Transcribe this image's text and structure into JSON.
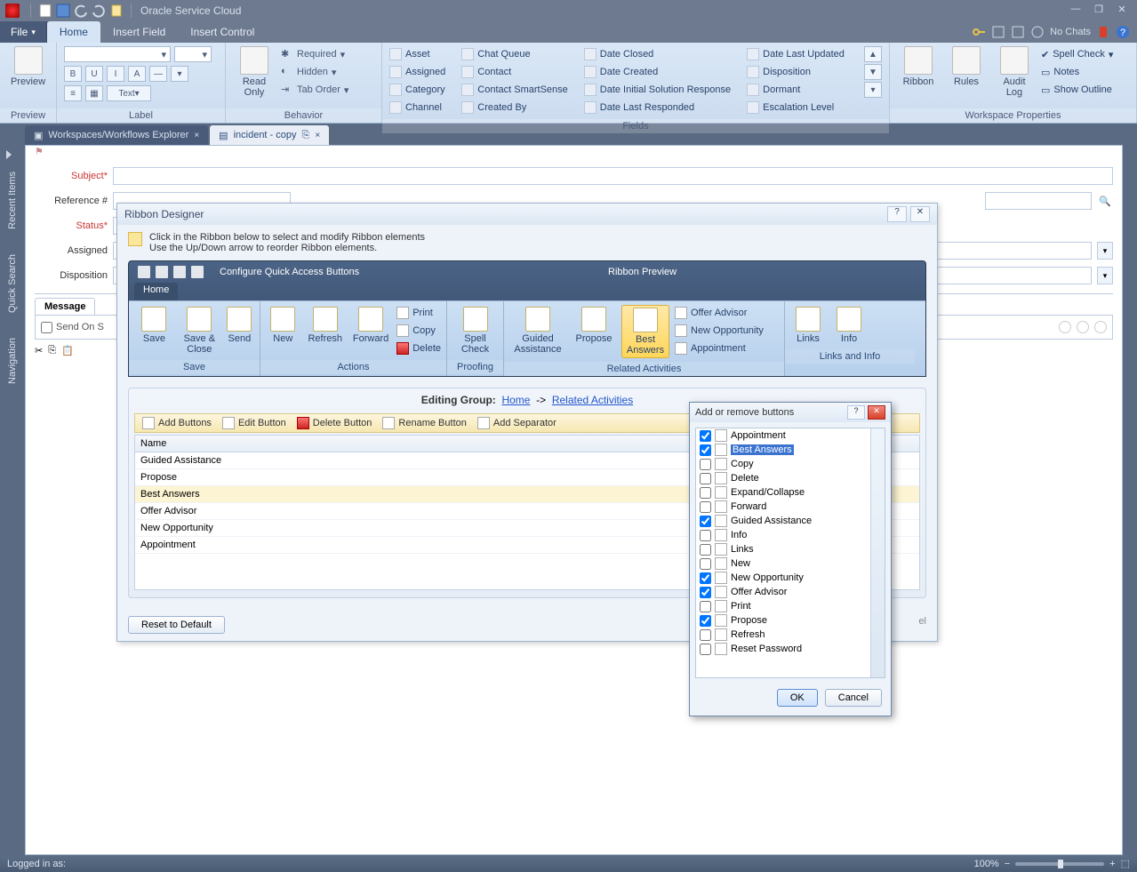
{
  "titlebar": {
    "app_title": "Oracle Service Cloud"
  },
  "menubar": {
    "file": "File",
    "tabs": [
      "Home",
      "Insert Field",
      "Insert Control"
    ],
    "no_chats": "No Chats"
  },
  "ribbon": {
    "groups": {
      "preview": {
        "label": "Preview",
        "btn": "Preview"
      },
      "label": {
        "label": "Label",
        "font_buttons": [
          "B",
          "U",
          "I"
        ],
        "text_btn": "Text"
      },
      "behavior": {
        "label": "Behavior",
        "read_only": "Read\nOnly",
        "items": [
          "Required",
          "Hidden",
          "Tab Order"
        ]
      },
      "fields": {
        "label": "Fields",
        "cols": [
          [
            "Asset",
            "Assigned",
            "Category",
            "Channel"
          ],
          [
            "Chat Queue",
            "Contact",
            "Contact SmartSense",
            "Created By"
          ],
          [
            "Date Closed",
            "Date Created",
            "Date Initial Solution Response",
            "Date Last Responded"
          ],
          [
            "Date Last Updated",
            "Disposition",
            "Dormant",
            "Escalation Level"
          ]
        ]
      },
      "wprops": {
        "label": "Workspace Properties",
        "big": [
          "Ribbon",
          "Rules",
          "Audit\nLog"
        ],
        "side": [
          "Spell Check",
          "Notes",
          "Show Outline"
        ]
      }
    }
  },
  "doctabs": {
    "items": [
      {
        "label": "Workspaces/Workflows Explorer"
      },
      {
        "label": "incident - copy"
      }
    ]
  },
  "sidebar": {
    "items": [
      "Recent Items",
      "Quick Search",
      "Navigation"
    ]
  },
  "form": {
    "subject": "Subject*",
    "reference": "Reference #",
    "status": "Status*",
    "assigned": "Assigned",
    "disposition": "Disposition",
    "messages_tab": "Message",
    "send_on_save": "Send On S"
  },
  "ribbon_designer": {
    "title": "Ribbon Designer",
    "help_line1": "Click in the Ribbon below to select and modify Ribbon elements",
    "help_line2": "Use the Up/Down arrow to reorder Ribbon elements.",
    "configure_qa": "Configure Quick Access Buttons",
    "preview_title": "Ribbon Preview",
    "home_tab": "Home",
    "groups": {
      "save": {
        "label": "Save",
        "btns": [
          "Save",
          "Save &\nClose",
          "Send"
        ]
      },
      "actions": {
        "label": "Actions",
        "btns": [
          "New",
          "Refresh",
          "Forward"
        ],
        "mini": [
          "Print",
          "Copy",
          "Delete"
        ]
      },
      "proofing": {
        "label": "Proofing",
        "btn": "Spell\nCheck"
      },
      "related": {
        "label": "Related Activities",
        "btns": [
          "Guided\nAssistance",
          "Propose",
          "Best\nAnswers"
        ],
        "side": [
          "Offer Advisor",
          "New Opportunity",
          "Appointment"
        ]
      },
      "links": {
        "label": "Links and Info",
        "btns": [
          "Links",
          "Info"
        ]
      }
    },
    "editor": {
      "editing_group": "Editing Group:",
      "crumb_home": "Home",
      "crumb_arrow": "->",
      "crumb_group": "Related Activities",
      "toolbar": [
        "Add Buttons",
        "Edit Button",
        "Delete Button",
        "Rename Button",
        "Add Separator"
      ],
      "name_header": "Name",
      "rows": [
        "Guided Assistance",
        "Propose",
        "Best Answers",
        "Offer Advisor",
        "New Opportunity",
        "Appointment"
      ]
    },
    "reset": "Reset to Default",
    "hint": "el"
  },
  "add_remove": {
    "title": "Add or remove buttons",
    "items": [
      {
        "label": "Appointment",
        "checked": true
      },
      {
        "label": "Best Answers",
        "checked": true,
        "selected": true
      },
      {
        "label": "Copy",
        "checked": false
      },
      {
        "label": "Delete",
        "checked": false
      },
      {
        "label": "Expand/Collapse",
        "checked": false
      },
      {
        "label": "Forward",
        "checked": false
      },
      {
        "label": "Guided Assistance",
        "checked": true
      },
      {
        "label": "Info",
        "checked": false
      },
      {
        "label": "Links",
        "checked": false
      },
      {
        "label": "New",
        "checked": false
      },
      {
        "label": "New Opportunity",
        "checked": true
      },
      {
        "label": "Offer Advisor",
        "checked": true
      },
      {
        "label": "Print",
        "checked": false
      },
      {
        "label": "Propose",
        "checked": true
      },
      {
        "label": "Refresh",
        "checked": false
      },
      {
        "label": "Reset Password",
        "checked": false
      }
    ],
    "ok": "OK",
    "cancel": "Cancel"
  },
  "statusbar": {
    "logged_in": "Logged in as:",
    "zoom": "100%"
  }
}
